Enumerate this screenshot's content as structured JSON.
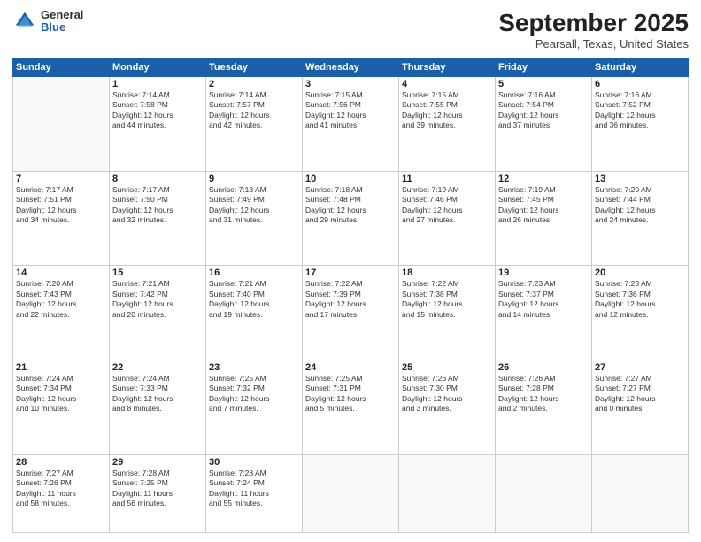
{
  "header": {
    "logo_general": "General",
    "logo_blue": "Blue",
    "month_title": "September 2025",
    "location": "Pearsall, Texas, United States"
  },
  "days_of_week": [
    "Sunday",
    "Monday",
    "Tuesday",
    "Wednesday",
    "Thursday",
    "Friday",
    "Saturday"
  ],
  "weeks": [
    [
      {
        "day": "",
        "info": ""
      },
      {
        "day": "1",
        "info": "Sunrise: 7:14 AM\nSunset: 7:58 PM\nDaylight: 12 hours\nand 44 minutes."
      },
      {
        "day": "2",
        "info": "Sunrise: 7:14 AM\nSunset: 7:57 PM\nDaylight: 12 hours\nand 42 minutes."
      },
      {
        "day": "3",
        "info": "Sunrise: 7:15 AM\nSunset: 7:56 PM\nDaylight: 12 hours\nand 41 minutes."
      },
      {
        "day": "4",
        "info": "Sunrise: 7:15 AM\nSunset: 7:55 PM\nDaylight: 12 hours\nand 39 minutes."
      },
      {
        "day": "5",
        "info": "Sunrise: 7:16 AM\nSunset: 7:54 PM\nDaylight: 12 hours\nand 37 minutes."
      },
      {
        "day": "6",
        "info": "Sunrise: 7:16 AM\nSunset: 7:52 PM\nDaylight: 12 hours\nand 36 minutes."
      }
    ],
    [
      {
        "day": "7",
        "info": "Sunrise: 7:17 AM\nSunset: 7:51 PM\nDaylight: 12 hours\nand 34 minutes."
      },
      {
        "day": "8",
        "info": "Sunrise: 7:17 AM\nSunset: 7:50 PM\nDaylight: 12 hours\nand 32 minutes."
      },
      {
        "day": "9",
        "info": "Sunrise: 7:18 AM\nSunset: 7:49 PM\nDaylight: 12 hours\nand 31 minutes."
      },
      {
        "day": "10",
        "info": "Sunrise: 7:18 AM\nSunset: 7:48 PM\nDaylight: 12 hours\nand 29 minutes."
      },
      {
        "day": "11",
        "info": "Sunrise: 7:19 AM\nSunset: 7:46 PM\nDaylight: 12 hours\nand 27 minutes."
      },
      {
        "day": "12",
        "info": "Sunrise: 7:19 AM\nSunset: 7:45 PM\nDaylight: 12 hours\nand 26 minutes."
      },
      {
        "day": "13",
        "info": "Sunrise: 7:20 AM\nSunset: 7:44 PM\nDaylight: 12 hours\nand 24 minutes."
      }
    ],
    [
      {
        "day": "14",
        "info": "Sunrise: 7:20 AM\nSunset: 7:43 PM\nDaylight: 12 hours\nand 22 minutes."
      },
      {
        "day": "15",
        "info": "Sunrise: 7:21 AM\nSunset: 7:42 PM\nDaylight: 12 hours\nand 20 minutes."
      },
      {
        "day": "16",
        "info": "Sunrise: 7:21 AM\nSunset: 7:40 PM\nDaylight: 12 hours\nand 19 minutes."
      },
      {
        "day": "17",
        "info": "Sunrise: 7:22 AM\nSunset: 7:39 PM\nDaylight: 12 hours\nand 17 minutes."
      },
      {
        "day": "18",
        "info": "Sunrise: 7:22 AM\nSunset: 7:38 PM\nDaylight: 12 hours\nand 15 minutes."
      },
      {
        "day": "19",
        "info": "Sunrise: 7:23 AM\nSunset: 7:37 PM\nDaylight: 12 hours\nand 14 minutes."
      },
      {
        "day": "20",
        "info": "Sunrise: 7:23 AM\nSunset: 7:36 PM\nDaylight: 12 hours\nand 12 minutes."
      }
    ],
    [
      {
        "day": "21",
        "info": "Sunrise: 7:24 AM\nSunset: 7:34 PM\nDaylight: 12 hours\nand 10 minutes."
      },
      {
        "day": "22",
        "info": "Sunrise: 7:24 AM\nSunset: 7:33 PM\nDaylight: 12 hours\nand 8 minutes."
      },
      {
        "day": "23",
        "info": "Sunrise: 7:25 AM\nSunset: 7:32 PM\nDaylight: 12 hours\nand 7 minutes."
      },
      {
        "day": "24",
        "info": "Sunrise: 7:25 AM\nSunset: 7:31 PM\nDaylight: 12 hours\nand 5 minutes."
      },
      {
        "day": "25",
        "info": "Sunrise: 7:26 AM\nSunset: 7:30 PM\nDaylight: 12 hours\nand 3 minutes."
      },
      {
        "day": "26",
        "info": "Sunrise: 7:26 AM\nSunset: 7:28 PM\nDaylight: 12 hours\nand 2 minutes."
      },
      {
        "day": "27",
        "info": "Sunrise: 7:27 AM\nSunset: 7:27 PM\nDaylight: 12 hours\nand 0 minutes."
      }
    ],
    [
      {
        "day": "28",
        "info": "Sunrise: 7:27 AM\nSunset: 7:26 PM\nDaylight: 11 hours\nand 58 minutes."
      },
      {
        "day": "29",
        "info": "Sunrise: 7:28 AM\nSunset: 7:25 PM\nDaylight: 11 hours\nand 56 minutes."
      },
      {
        "day": "30",
        "info": "Sunrise: 7:28 AM\nSunset: 7:24 PM\nDaylight: 11 hours\nand 55 minutes."
      },
      {
        "day": "",
        "info": ""
      },
      {
        "day": "",
        "info": ""
      },
      {
        "day": "",
        "info": ""
      },
      {
        "day": "",
        "info": ""
      }
    ]
  ]
}
